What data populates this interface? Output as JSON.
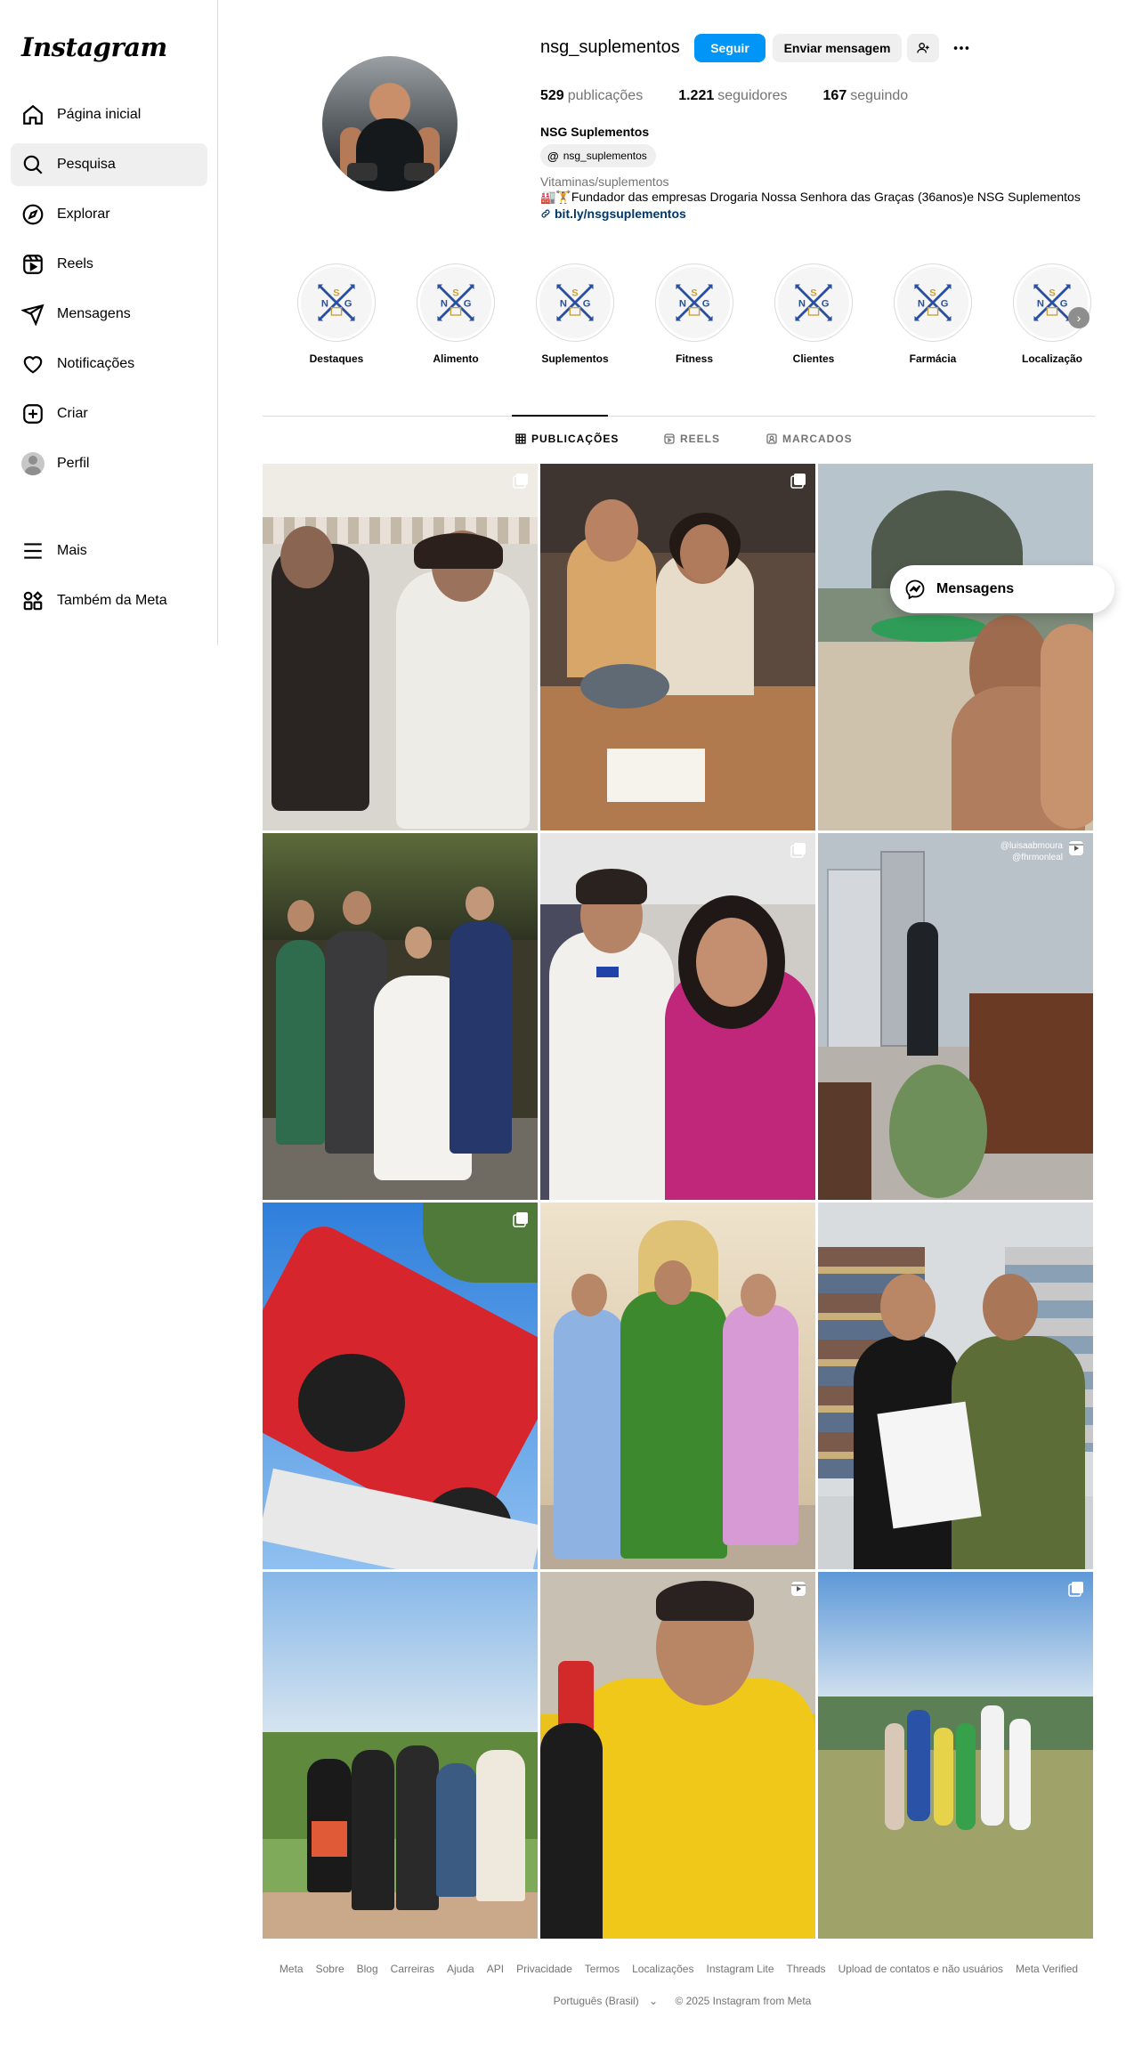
{
  "app": {
    "logo": "Instagram"
  },
  "sidebar": {
    "items": [
      {
        "label": "Página inicial",
        "icon": "home-icon"
      },
      {
        "label": "Pesquisa",
        "icon": "search-icon",
        "active": true
      },
      {
        "label": "Explorar",
        "icon": "compass-icon"
      },
      {
        "label": "Reels",
        "icon": "reels-icon"
      },
      {
        "label": "Mensagens",
        "icon": "messages-icon"
      },
      {
        "label": "Notificações",
        "icon": "heart-icon"
      },
      {
        "label": "Criar",
        "icon": "plus-icon"
      },
      {
        "label": "Perfil",
        "icon": "avatar"
      }
    ],
    "bottom": [
      {
        "label": "Mais",
        "icon": "menu-icon"
      },
      {
        "label": "Também da Meta",
        "icon": "meta-apps-icon"
      }
    ]
  },
  "profile": {
    "username": "nsg_suplementos",
    "follow_label": "Seguir",
    "message_label": "Enviar mensagem",
    "stats": {
      "posts_count": "529",
      "posts_label": "publicações",
      "followers_count": "1.221",
      "followers_label": "seguidores",
      "following_count": "167",
      "following_label": "seguindo"
    },
    "full_name": "NSG Suplementos",
    "threads_handle": "nsg_suplementos",
    "category": "Vitaminas/suplementos",
    "bio": "🏭🏋️Fundador das empresas Drogaria Nossa Senhora das Graças (36anos)e NSG Suplementos",
    "link": "bit.ly/nsgsuplementos"
  },
  "highlights": [
    {
      "label": "Destaques"
    },
    {
      "label": "Alimento"
    },
    {
      "label": "Suplementos"
    },
    {
      "label": "Fitness"
    },
    {
      "label": "Clientes"
    },
    {
      "label": "Farmácia"
    },
    {
      "label": "Localização"
    }
  ],
  "tabs": [
    {
      "label": "PUBLICAÇÕES",
      "active": true
    },
    {
      "label": "REELS"
    },
    {
      "label": "MARCADOS"
    }
  ],
  "posts": [
    {
      "badge": "carousel-icon"
    },
    {
      "badge": "carousel-icon"
    },
    {
      "badge": ""
    },
    {
      "badge": ""
    },
    {
      "badge": "carousel-icon"
    },
    {
      "badge": "reel-icon",
      "overlay_text": "@luisaabmoura\n@fhrmonleal"
    },
    {
      "badge": "carousel-icon"
    },
    {
      "badge": ""
    },
    {
      "badge": ""
    },
    {
      "badge": ""
    },
    {
      "badge": "reel-icon"
    },
    {
      "badge": "carousel-icon"
    }
  ],
  "floating_messages": {
    "label": "Mensagens"
  },
  "footer": {
    "links": [
      "Meta",
      "Sobre",
      "Blog",
      "Carreiras",
      "Ajuda",
      "API",
      "Privacidade",
      "Termos",
      "Localizações",
      "Instagram Lite",
      "Threads",
      "Upload de contatos e não usuários",
      "Meta Verified"
    ],
    "language": "Português (Brasil)",
    "copyright": "© 2025 Instagram from Meta"
  },
  "colors": {
    "accent": "#0095f6",
    "border": "#dbdbdb",
    "muted": "#737373",
    "link": "#00376b"
  }
}
